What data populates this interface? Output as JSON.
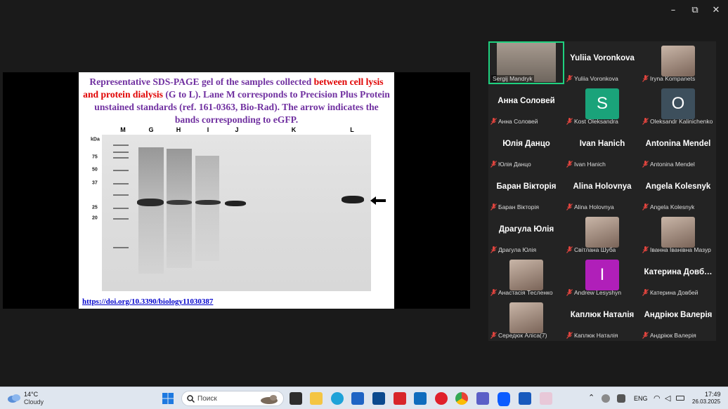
{
  "window": {
    "minimize_label": "–",
    "restore_label": "⧉",
    "close_label": "✕"
  },
  "slide": {
    "title_part1": "Representative SDS-PAGE gel of the samples collected ",
    "title_red": "between cell lysis and protein dialysis",
    "title_part2": " (G to L). Lane M corresponds to Precision Plus Protein unstained standards (ref. 161-0363, Bio-Rad). The arrow indicates the bands corresponding to eGFP.",
    "doi": "https://doi.org/10.3390/biology11030387",
    "lanes": [
      "M",
      "G",
      "H",
      "I",
      "J",
      "K",
      "L"
    ],
    "kda_title": "kDa",
    "kda_marks": [
      "75",
      "50",
      "37",
      "25",
      "20"
    ]
  },
  "participants": [
    {
      "label": "Sergij Mandryk",
      "big": "",
      "kind": "video"
    },
    {
      "label": "Yuliia Voronkova",
      "big": "Yuliia Voronkova",
      "kind": "name"
    },
    {
      "label": "Iryna Kompanets",
      "big": "",
      "kind": "photo"
    },
    {
      "label": "Анна Соловей",
      "big": "Анна Соловей",
      "kind": "name"
    },
    {
      "label": "Kost Oleksandra",
      "big": "S",
      "kind": "letter",
      "color": "#1aa37a"
    },
    {
      "label": "Oleksandr Kalinichenko",
      "big": "O",
      "kind": "letter",
      "color": "#3d4f5c"
    },
    {
      "label": "Юлія Данцо",
      "big": "Юлія Данцо",
      "kind": "name"
    },
    {
      "label": "Ivan Hanich",
      "big": "Ivan Hanich",
      "kind": "name"
    },
    {
      "label": "Antonina Mendel",
      "big": "Antonina Mendel",
      "kind": "name"
    },
    {
      "label": "Баран Вікторія",
      "big": "Баран Вікторія",
      "kind": "name"
    },
    {
      "label": "Alina Holovnya",
      "big": "Alina Holovnya",
      "kind": "name"
    },
    {
      "label": "Angela Kolesnyk",
      "big": "Angela Kolesnyk",
      "kind": "name"
    },
    {
      "label": "Драгула Юлія",
      "big": "Драгула Юлія",
      "kind": "name"
    },
    {
      "label": "Світлана Шуба",
      "big": "",
      "kind": "photo"
    },
    {
      "label": "Іванна Іванівна Мазур",
      "big": "",
      "kind": "photo"
    },
    {
      "label": "Анастасія Тесленко",
      "big": "",
      "kind": "photo"
    },
    {
      "label": "Andrew Lesyshyn",
      "big": "I",
      "kind": "letter",
      "color": "#b01fb9"
    },
    {
      "label": "Катерина Довбей",
      "big": "Катерина Довб…",
      "kind": "name"
    },
    {
      "label": "Середюк Аліса(7)",
      "big": "",
      "kind": "photo"
    },
    {
      "label": "Каплюк Наталія",
      "big": "Каплюк Наталія",
      "kind": "name"
    },
    {
      "label": "Андріюк Валерія",
      "big": "Андріюк Валерія",
      "kind": "name"
    }
  ],
  "taskbar": {
    "weather_temp": "14°C",
    "weather_desc": "Cloudy",
    "search_placeholder": "Поиск",
    "lang": "ENG",
    "time": "17:49",
    "date": "26.03.2025"
  },
  "colors": {
    "active_speaker": "#1fd17f",
    "muted_red": "#e0443e",
    "slide_purple": "#7030a0",
    "slide_red": "#e00000"
  }
}
